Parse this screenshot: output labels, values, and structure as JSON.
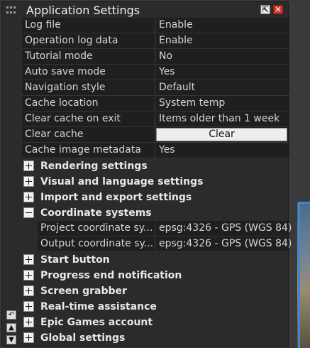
{
  "window": {
    "title": "Application Settings",
    "restore_symbol": "⇱",
    "close_symbol": "✕"
  },
  "properties": [
    {
      "label": "Log file",
      "value": "Enable"
    },
    {
      "label": "Operation log data",
      "value": "Enable"
    },
    {
      "label": "Tutorial mode",
      "value": "No"
    },
    {
      "label": "Auto save mode",
      "value": "Yes"
    },
    {
      "label": "Navigation style",
      "value": "Default"
    },
    {
      "label": "Cache location",
      "value": "System temp"
    },
    {
      "label": "Clear cache on exit",
      "value": "Items older than 1 week"
    },
    {
      "label": "Clear cache",
      "button": "Clear"
    },
    {
      "label": "Cache image metadata",
      "value": "Yes"
    }
  ],
  "sections": [
    {
      "label": "Rendering settings",
      "expanded": false
    },
    {
      "label": "Visual and language settings",
      "expanded": false
    },
    {
      "label": "Import and export settings",
      "expanded": false
    },
    {
      "label": "Coordinate systems",
      "expanded": true
    },
    {
      "label": "Start button",
      "expanded": false
    },
    {
      "label": "Progress end notification",
      "expanded": false
    },
    {
      "label": "Screen grabber",
      "expanded": false
    },
    {
      "label": "Real-time assistance",
      "expanded": false
    },
    {
      "label": "Epic Games account",
      "expanded": false
    },
    {
      "label": "Global settings",
      "expanded": false
    }
  ],
  "coordinate_systems": [
    {
      "label": "Project coordinate sy...",
      "value": "epsg:4326 - GPS (WGS 84)"
    },
    {
      "label": "Output coordinate sy...",
      "value": "epsg:4326 - GPS (WGS 84)"
    }
  ],
  "rail": {
    "undo_symbol": "↶",
    "up_symbol": "▲",
    "down_symbol": "▼"
  },
  "colors": {
    "panel_bg": "#2b2b2b",
    "row_bg": "#1f1f1f",
    "close_red": "#d9362e",
    "accent_blue": "#3f86d4"
  }
}
